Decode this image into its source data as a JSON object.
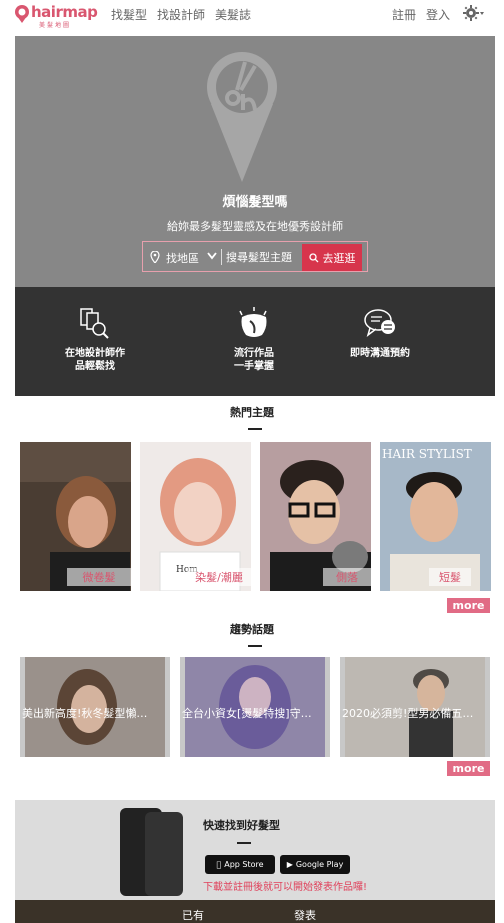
{
  "nav": {
    "logo_text": "hairmap",
    "logo_sub": "美髮地圖",
    "links": [
      "找髮型",
      "找設計師",
      "美髮誌"
    ],
    "register": "註冊",
    "login": "登入"
  },
  "hero": {
    "title": "煩惱髮型嗎",
    "subtitle": "給妳最多髮型靈感及在地優秀設計師",
    "area_select": "找地區",
    "topic_placeholder": "搜尋髮型主題",
    "go_button": "去逛逛"
  },
  "features": [
    {
      "label_line1": "在地設計師作",
      "label_line2": "品輕鬆找",
      "icon": "designer-search-icon"
    },
    {
      "label_line1": "流行作品",
      "label_line2": "一手掌握",
      "icon": "trend-works-icon"
    },
    {
      "label_line1": "即時溝通預約",
      "label_line2": "",
      "icon": "chat-icon"
    }
  ],
  "hot_topics": {
    "title": "熱門主題",
    "items": [
      "微卷髮",
      "染髮/潮麗",
      "側落",
      "短髮"
    ],
    "more": "more"
  },
  "trends": {
    "title": "趨勢話題",
    "items": [
      "美出新高度!秋冬髮型懶…",
      "全台小資女[燙髮特搜]守…",
      "2020必須剪!型男必備五…"
    ],
    "more": "more"
  },
  "app_banner": {
    "title": "快速找到好髮型",
    "app_store": "App Store",
    "google_play": "Google Play",
    "note": "下載並註冊後就可以開始發表作品囉!"
  },
  "bottom": {
    "text1": "已有",
    "text2": "發表"
  }
}
